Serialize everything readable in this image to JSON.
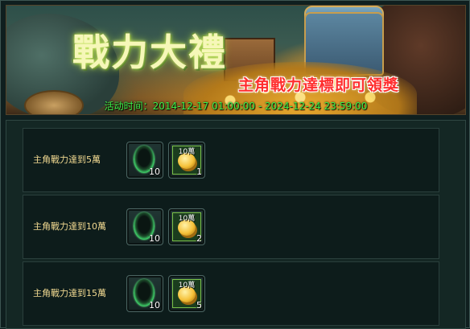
{
  "banner": {
    "title": "戰力大禮",
    "subtitle": "主角戰力達標即可領獎",
    "time": "活动时间：2014-12-17 01:00:00 - 2024-12-24 23:59:00"
  },
  "rewards": [
    {
      "condition": "主角戰力達到5萬",
      "items": [
        {
          "icon": "green-gem-icon",
          "count": "10"
        },
        {
          "icon": "gold-coin-icon",
          "tag": "10萬",
          "count": "1"
        }
      ]
    },
    {
      "condition": "主角戰力達到10萬",
      "items": [
        {
          "icon": "green-gem-icon",
          "count": "10"
        },
        {
          "icon": "gold-coin-icon",
          "tag": "10萬",
          "count": "2"
        }
      ]
    },
    {
      "condition": "主角戰力達到15萬",
      "items": [
        {
          "icon": "green-gem-icon",
          "count": "10"
        },
        {
          "icon": "gold-coin-icon",
          "tag": "10萬",
          "count": "5"
        }
      ]
    }
  ]
}
